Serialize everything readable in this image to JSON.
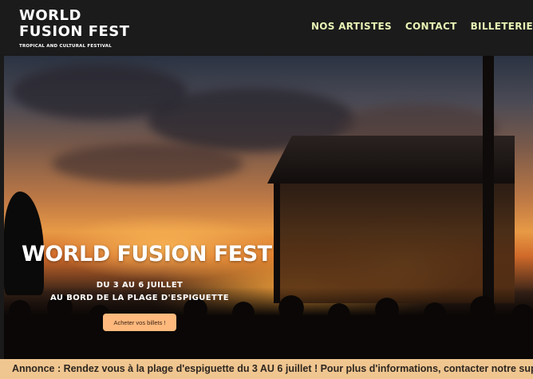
{
  "header": {
    "logo_line1": "WORLD",
    "logo_line2": "FUSION FEST",
    "tagline": "TROPICAL AND CULTURAL FESTIVAL",
    "nav": [
      "NOS ARTISTES",
      "CONTACT",
      "BILLETERIE"
    ]
  },
  "hero": {
    "title": "WORLD FUSION FEST",
    "dates_line1": "DU 3 AU 6 JUILLET",
    "dates_line2": "AU BORD DE LA PLAGE D'ESPIGUETTE",
    "cta_label": "Acheter vos billets !"
  },
  "announcement": {
    "text": "Annonce : Rendez vous à la plage d'espiguette du 3 AU 6 juillet ! Pour plus d'informations, contacter notre support par mail"
  },
  "colors": {
    "header_bg": "#1b1b1b",
    "nav_text": "#e6f2b4",
    "cta_bg": "#ffb97d",
    "announce_bg": "#f0c690"
  }
}
